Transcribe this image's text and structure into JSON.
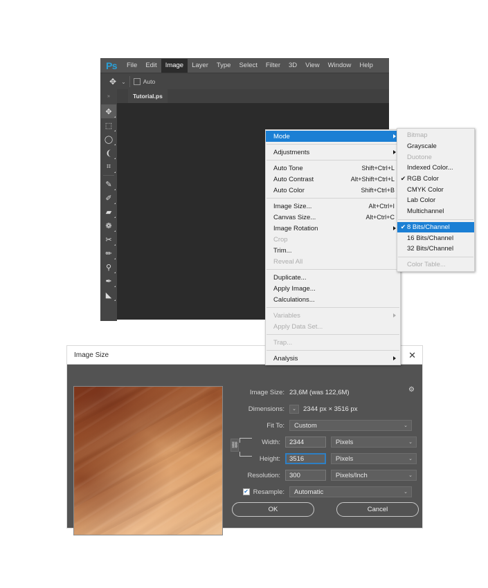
{
  "app": {
    "logo": "Ps",
    "menubar": [
      "File",
      "Edit",
      "Image",
      "Layer",
      "Type",
      "Select",
      "Filter",
      "3D",
      "View",
      "Window",
      "Help"
    ],
    "active_menu": "Image",
    "document_tab": "Tutorial.ps",
    "options_bar": {
      "tool_glyph": "✥",
      "chevron": "⌄",
      "auto_label": "Auto"
    },
    "collapse_glyph": "»",
    "tools": [
      {
        "name": "move-tool",
        "glyph": "✥",
        "selected": true
      },
      {
        "name": "rectangular-marquee-tool",
        "glyph": "⬚",
        "selected": false
      },
      {
        "name": "lasso-tool",
        "glyph": "◯",
        "selected": false
      },
      {
        "name": "quick-selection-tool",
        "glyph": "❨",
        "selected": false
      },
      {
        "name": "crop-tool",
        "glyph": "⌗",
        "selected": false
      },
      {
        "name": "eyedropper-tool",
        "glyph": "✎",
        "selected": false
      },
      {
        "name": "spot-healing-brush-tool",
        "glyph": "✐",
        "selected": false
      },
      {
        "name": "patch-tool",
        "glyph": "▰",
        "selected": false
      },
      {
        "name": "brush-tool-group",
        "glyph": "❁",
        "selected": false
      },
      {
        "name": "shuffle-tool",
        "glyph": "✂",
        "selected": false
      },
      {
        "name": "paintbrush-tool",
        "glyph": "✏",
        "selected": false
      },
      {
        "name": "clone-stamp-tool",
        "glyph": "⚲",
        "selected": false
      },
      {
        "name": "history-brush-tool",
        "glyph": "✒",
        "selected": false
      },
      {
        "name": "eraser-tool",
        "glyph": "◣",
        "selected": false
      }
    ]
  },
  "image_menu": {
    "items": [
      {
        "label": "Mode",
        "shortcut": "",
        "submenu": true,
        "highlighted": true,
        "disabled": false
      },
      {
        "separator": true
      },
      {
        "label": "Adjustments",
        "shortcut": "",
        "submenu": true,
        "highlighted": false,
        "disabled": false
      },
      {
        "separator": true
      },
      {
        "label": "Auto Tone",
        "shortcut": "Shift+Ctrl+L",
        "submenu": false,
        "highlighted": false,
        "disabled": false
      },
      {
        "label": "Auto Contrast",
        "shortcut": "Alt+Shift+Ctrl+L",
        "submenu": false,
        "highlighted": false,
        "disabled": false
      },
      {
        "label": "Auto Color",
        "shortcut": "Shift+Ctrl+B",
        "submenu": false,
        "highlighted": false,
        "disabled": false
      },
      {
        "separator": true
      },
      {
        "label": "Image Size...",
        "shortcut": "Alt+Ctrl+I",
        "submenu": false,
        "highlighted": false,
        "disabled": false
      },
      {
        "label": "Canvas Size...",
        "shortcut": "Alt+Ctrl+C",
        "submenu": false,
        "highlighted": false,
        "disabled": false
      },
      {
        "label": "Image Rotation",
        "shortcut": "",
        "submenu": true,
        "highlighted": false,
        "disabled": false
      },
      {
        "label": "Crop",
        "shortcut": "",
        "submenu": false,
        "highlighted": false,
        "disabled": true
      },
      {
        "label": "Trim...",
        "shortcut": "",
        "submenu": false,
        "highlighted": false,
        "disabled": false
      },
      {
        "label": "Reveal All",
        "shortcut": "",
        "submenu": false,
        "highlighted": false,
        "disabled": true
      },
      {
        "separator": true
      },
      {
        "label": "Duplicate...",
        "shortcut": "",
        "submenu": false,
        "highlighted": false,
        "disabled": false
      },
      {
        "label": "Apply Image...",
        "shortcut": "",
        "submenu": false,
        "highlighted": false,
        "disabled": false
      },
      {
        "label": "Calculations...",
        "shortcut": "",
        "submenu": false,
        "highlighted": false,
        "disabled": false
      },
      {
        "separator": true
      },
      {
        "label": "Variables",
        "shortcut": "",
        "submenu": true,
        "highlighted": false,
        "disabled": true
      },
      {
        "label": "Apply Data Set...",
        "shortcut": "",
        "submenu": false,
        "highlighted": false,
        "disabled": true
      },
      {
        "separator": true
      },
      {
        "label": "Trap...",
        "shortcut": "",
        "submenu": false,
        "highlighted": false,
        "disabled": true
      },
      {
        "separator": true
      },
      {
        "label": "Analysis",
        "shortcut": "",
        "submenu": true,
        "highlighted": false,
        "disabled": false
      }
    ]
  },
  "mode_submenu": {
    "items": [
      {
        "label": "Bitmap",
        "checked": false,
        "highlighted": false,
        "disabled": true
      },
      {
        "label": "Grayscale",
        "checked": false,
        "highlighted": false,
        "disabled": false
      },
      {
        "label": "Duotone",
        "checked": false,
        "highlighted": false,
        "disabled": true
      },
      {
        "label": "Indexed Color...",
        "checked": false,
        "highlighted": false,
        "disabled": false
      },
      {
        "label": "RGB Color",
        "checked": true,
        "highlighted": false,
        "disabled": false
      },
      {
        "label": "CMYK Color",
        "checked": false,
        "highlighted": false,
        "disabled": false
      },
      {
        "label": "Lab Color",
        "checked": false,
        "highlighted": false,
        "disabled": false
      },
      {
        "label": "Multichannel",
        "checked": false,
        "highlighted": false,
        "disabled": false
      },
      {
        "separator": true
      },
      {
        "label": "8 Bits/Channel",
        "checked": true,
        "highlighted": true,
        "disabled": false
      },
      {
        "label": "16 Bits/Channel",
        "checked": false,
        "highlighted": false,
        "disabled": false
      },
      {
        "label": "32 Bits/Channel",
        "checked": false,
        "highlighted": false,
        "disabled": false
      },
      {
        "separator": true
      },
      {
        "label": "Color Table...",
        "checked": false,
        "highlighted": false,
        "disabled": true
      }
    ],
    "check_glyph": "✔"
  },
  "dialog": {
    "title": "Image Size",
    "close_glyph": "✕",
    "gear_glyph": "⚙",
    "image_size_label": "Image Size:",
    "image_size_value": "23,6M (was 122,6M)",
    "dimensions_label": "Dimensions:",
    "dimensions_value": "2344 px  ×  3516 px",
    "dimensions_caret": "⌄",
    "fit_to_label": "Fit To:",
    "fit_to_value": "Custom",
    "width_label": "Width:",
    "width_value": "2344",
    "width_unit": "Pixels",
    "height_label": "Height:",
    "height_value": "3516",
    "height_unit": "Pixels",
    "resolution_label": "Resolution:",
    "resolution_value": "300",
    "resolution_unit": "Pixels/Inch",
    "resample_label": "Resample:",
    "resample_value": "Automatic",
    "resample_checked": true,
    "check_glyph": "✔",
    "chain_glyph": "⛓",
    "caret_glyph": "⌄",
    "ok_label": "OK",
    "cancel_label": "Cancel"
  },
  "colors": {
    "accent_blue": "#1b7fd4",
    "ps_logo_blue": "#2a9fd6",
    "menu_bg": "#f0f0f0",
    "dialog_bg": "#535353",
    "ps_chrome": "#535353",
    "canvas_bg": "#2b2b2b"
  }
}
